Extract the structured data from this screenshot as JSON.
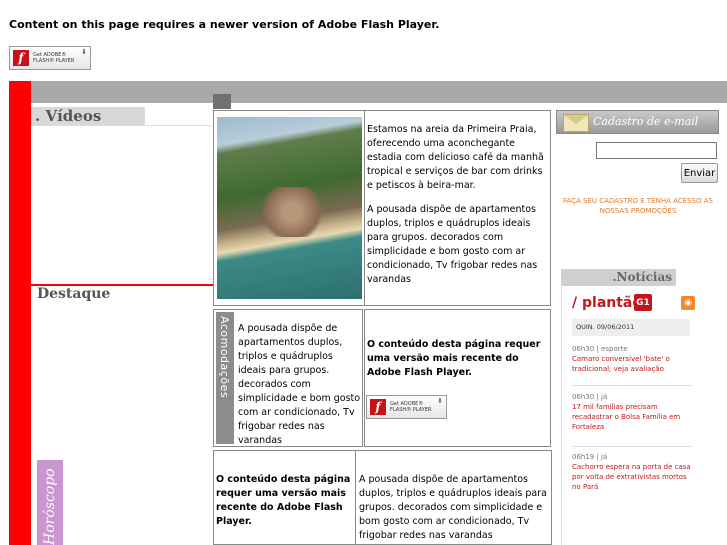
{
  "flash": {
    "top_message": "Content on this page requires a newer version of Adobe Flash Player.",
    "badge_line1": "Get ADOBE®",
    "badge_line2": "FLASH® PLAYER",
    "logo_glyph": "f"
  },
  "left": {
    "videos_title": ". Vídeos",
    "destaque_title": "Destaque",
    "horoscopo_label": "Horóscopo"
  },
  "content": {
    "intro_p1": "Estamos na areia da Primeira Praia, oferecendo uma aconchegante estadia com delicioso café da manhã tropical e serviços de bar com drinks e petiscos à beira-mar.",
    "intro_p2": "A pousada dispõe de apartamentos duplos, triplos e quádruplos ideais para grupos. decorados com simplicidade e bom gosto com ar condicionado, Tv frigobar redes nas varandas",
    "acomodacoes_label": "Acomodações",
    "acomod_text": "A pousada dispõe de apartamentos duplos, triplos e quádruplos ideais para grupos. decorados com simplicidade e bom gosto com ar condicionado, Tv frigobar redes nas varandas",
    "flash_notice": "O conteúdo desta página requer uma versão mais recente do Adobe Flash Player.",
    "bottom_flash_notice": "O conteúdo desta página requer uma versão mais recente do Adobe Flash Player.",
    "bottom_text": "A pousada dispõe de apartamentos duplos, triplos e quádruplos ideais para grupos. decorados com simplicidade e bom gosto com ar condicionado, Tv frigobar redes nas varandas"
  },
  "sidebar": {
    "cadastro_title": "Cadastro de e-mail",
    "email_value": "",
    "enviar_label": "Enviar",
    "faca_text": "FAÇA SEU CADASTRO E TENHA ACESSO AS NOSSAS PROMOÇÕES",
    "noticias_title": ".Notícias",
    "plantao_slash": "/ ",
    "plantao_word": "plantão",
    "g1_label": "G1",
    "rss_icon": "rss-icon",
    "news_date": "QUIN. 09/06/2011",
    "news": [
      {
        "meta": "06h30 | esporte",
        "headline": "Camaro conversível 'bate' o tradicional; veja avaliação"
      },
      {
        "meta": "06h30 | já",
        "headline": "17 mil famílias precisam recadastrar o Bolsa Família em Fortaleza"
      },
      {
        "meta": "06h19 | já",
        "headline": "Cachorro espera na porta de casa por volta de extrativistas mortos no Pará"
      }
    ]
  },
  "colors": {
    "red_bar": "#ff0000",
    "gray_bar": "#a9a9a9",
    "news_red": "#c4171c",
    "promo_orange": "#e07a2d",
    "horoscopo_pink": "#c996cf"
  }
}
